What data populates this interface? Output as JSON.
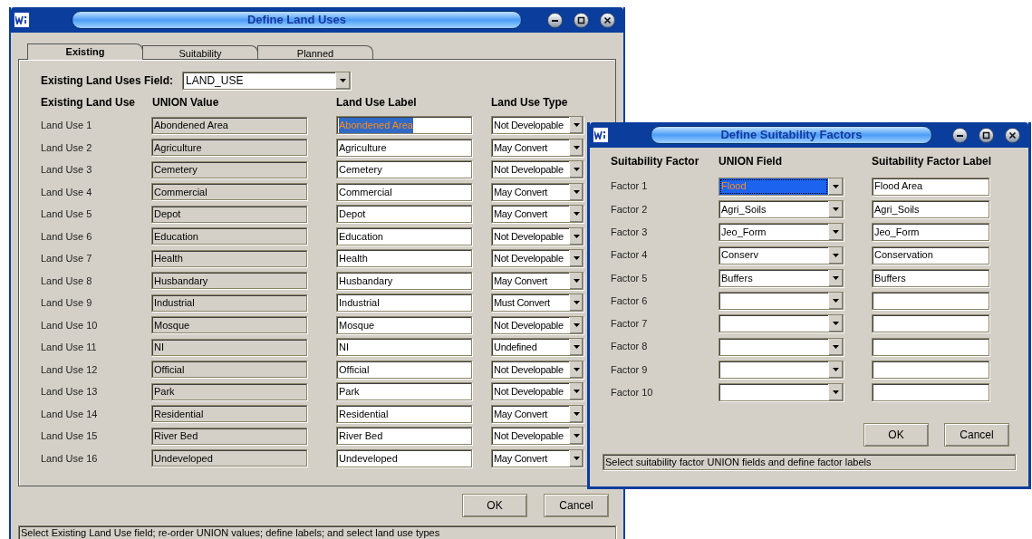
{
  "land_uses_window": {
    "title": "Define Land Uses",
    "tabs": [
      {
        "label": "Existing",
        "selected": true
      },
      {
        "label": "Suitability",
        "selected": false
      },
      {
        "label": "Planned",
        "selected": false
      }
    ],
    "field_label": "Existing Land Uses Field:",
    "field_value": "LAND_USE",
    "columns": [
      "Existing Land Use",
      "UNION Value",
      "Land Use Label",
      "Land Use Type"
    ],
    "rows": [
      {
        "name": "Land Use 1",
        "union_value": "Abondened Area",
        "label": "Abondened Area",
        "selected": true,
        "type": "Not Developable"
      },
      {
        "name": "Land Use 2",
        "union_value": "Agriculture",
        "label": "Agriculture",
        "selected": false,
        "type": "May Convert"
      },
      {
        "name": "Land Use 3",
        "union_value": "Cemetery",
        "label": "Cemetery",
        "selected": false,
        "type": "Not Developable"
      },
      {
        "name": "Land Use 4",
        "union_value": "Commercial",
        "label": "Commercial",
        "selected": false,
        "type": "May Convert"
      },
      {
        "name": "Land Use 5",
        "union_value": "Depot",
        "label": "Depot",
        "selected": false,
        "type": "May Convert"
      },
      {
        "name": "Land Use 6",
        "union_value": "Education",
        "label": "Education",
        "selected": false,
        "type": "Not Developable"
      },
      {
        "name": "Land Use 7",
        "union_value": "Health",
        "label": "Health",
        "selected": false,
        "type": "Not Developable"
      },
      {
        "name": "Land Use 8",
        "union_value": "Husbandary",
        "label": "Husbandary",
        "selected": false,
        "type": "May Convert"
      },
      {
        "name": "Land Use 9",
        "union_value": "Industrial",
        "label": "Industrial",
        "selected": false,
        "type": "Must Convert"
      },
      {
        "name": "Land Use 10",
        "union_value": "Mosque",
        "label": "Mosque",
        "selected": false,
        "type": "Not Developable"
      },
      {
        "name": "Land Use 11",
        "union_value": "NI",
        "label": "NI",
        "selected": false,
        "type": "Undefined"
      },
      {
        "name": "Land Use 12",
        "union_value": "Official",
        "label": "Official",
        "selected": false,
        "type": "Not Developable"
      },
      {
        "name": "Land Use 13",
        "union_value": "Park",
        "label": "Park",
        "selected": false,
        "type": "Not Developable"
      },
      {
        "name": "Land Use 14",
        "union_value": "Residential",
        "label": "Residential",
        "selected": false,
        "type": "May Convert"
      },
      {
        "name": "Land Use 15",
        "union_value": "River Bed",
        "label": "River Bed",
        "selected": false,
        "type": "Not Developable"
      },
      {
        "name": "Land Use 16",
        "union_value": "Undeveloped",
        "label": "Undeveloped",
        "selected": false,
        "type": "May Convert"
      }
    ],
    "buttons": [
      "OK",
      "Cancel"
    ],
    "status_bar": "Select Existing Land Use field; re-order UNION values; define labels; and select land use types"
  },
  "suitability_window": {
    "title": "Define Suitability Factors",
    "columns": [
      "Suitability Factor",
      "UNION Field",
      "Suitability Factor Label"
    ],
    "rows": [
      {
        "name": "Factor 1",
        "union_field": "Flood",
        "label": "Flood Area",
        "selected": true
      },
      {
        "name": "Factor 2",
        "union_field": "Agri_Soils",
        "label": "Agri_Soils",
        "selected": false
      },
      {
        "name": "Factor 3",
        "union_field": "Jeo_Form",
        "label": "Jeo_Form",
        "selected": false
      },
      {
        "name": "Factor 4",
        "union_field": "Conserv",
        "label": "Conservation",
        "selected": false
      },
      {
        "name": "Factor 5",
        "union_field": "Buffers",
        "label": "Buffers",
        "selected": false
      },
      {
        "name": "Factor 6",
        "selected": false
      },
      {
        "name": "Factor 7",
        "selected": false
      },
      {
        "name": "Factor 8",
        "selected": false
      },
      {
        "name": "Factor 9",
        "selected": false
      },
      {
        "name": "Factor 10",
        "selected": false
      }
    ],
    "buttons": [
      "OK",
      "Cancel"
    ],
    "status_bar": "Select suitability factor UNION fields and define factor labels"
  }
}
